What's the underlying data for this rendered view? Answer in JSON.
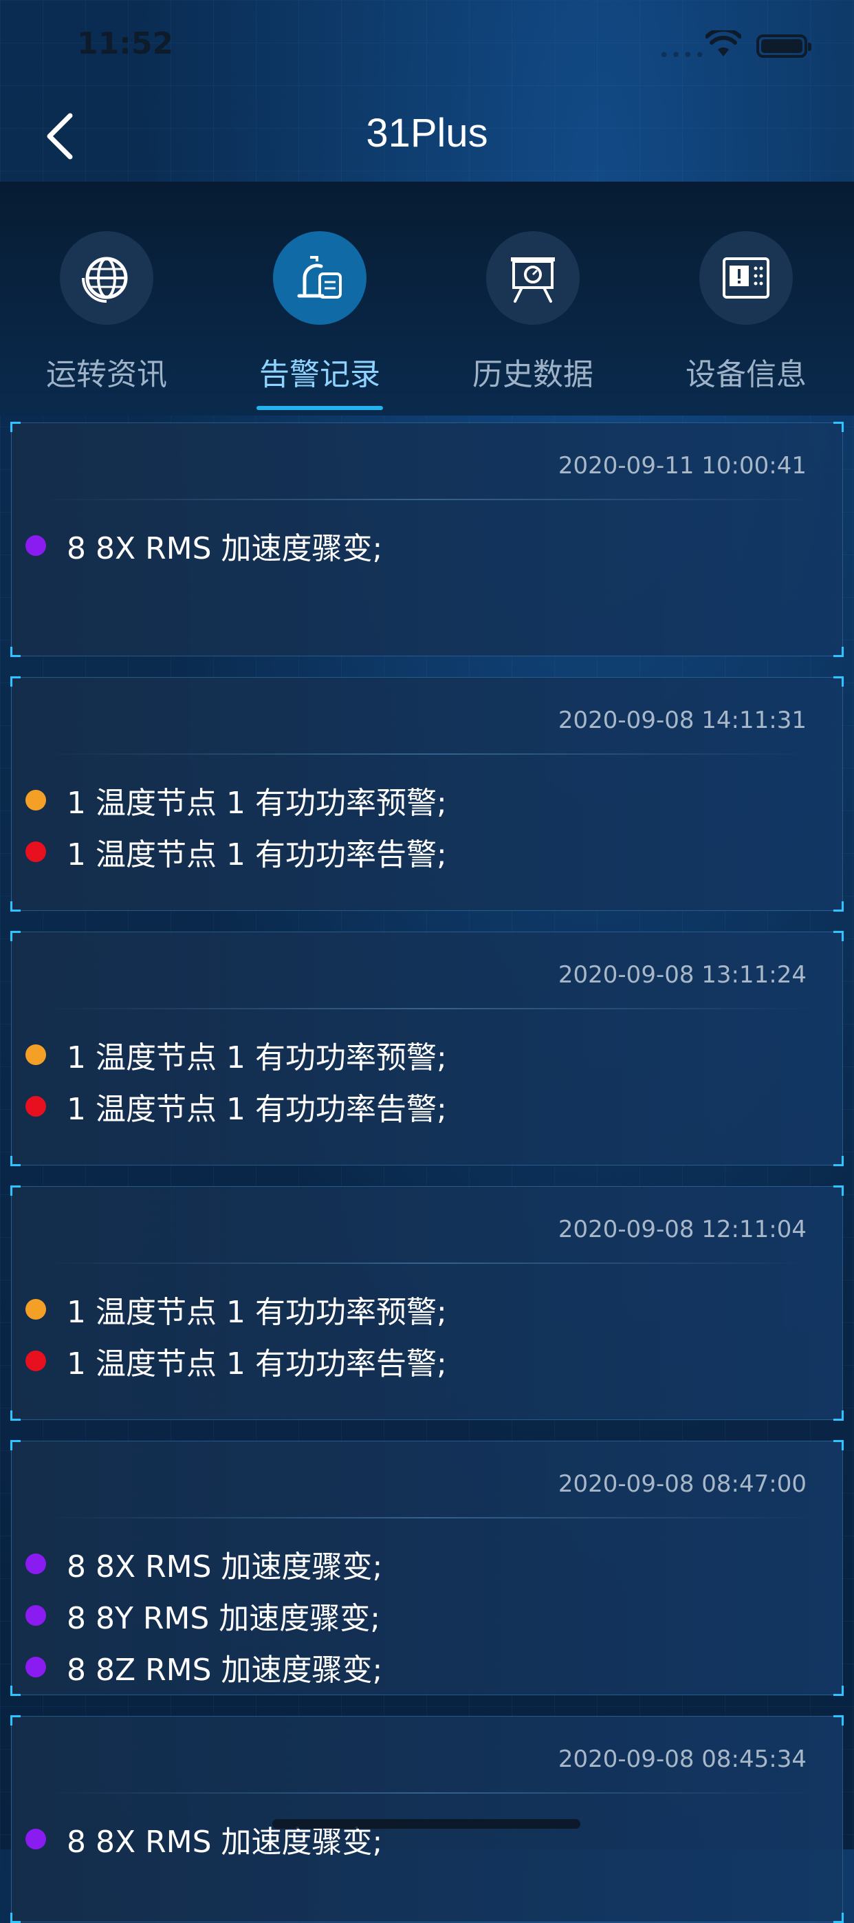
{
  "status": {
    "time": "11:52",
    "signal": "••••"
  },
  "nav": {
    "title": "31Plus"
  },
  "tabs": [
    {
      "label": "运转资讯",
      "icon": "globe-icon",
      "active": false
    },
    {
      "label": "告警记录",
      "icon": "alarm-bell-icon",
      "active": true
    },
    {
      "label": "历史数据",
      "icon": "presentation-gauge-icon",
      "active": false
    },
    {
      "label": "设备信息",
      "icon": "device-info-icon",
      "active": false
    }
  ],
  "colors": {
    "purple": "#8a1cf2",
    "orange": "#f4a026",
    "red": "#e8101e",
    "accent": "#25b3f0"
  },
  "records": [
    {
      "time": "2020-09-11 10:00:41",
      "alarms": [
        {
          "level": "purple",
          "text": "8 8X RMS 加速度骤变;"
        }
      ]
    },
    {
      "time": "2020-09-08 14:11:31",
      "alarms": [
        {
          "level": "orange",
          "text": "1 温度节点 1 有功功率预警;"
        },
        {
          "level": "red",
          "text": "1 温度节点 1 有功功率告警;"
        }
      ]
    },
    {
      "time": "2020-09-08 13:11:24",
      "alarms": [
        {
          "level": "orange",
          "text": "1 温度节点 1 有功功率预警;"
        },
        {
          "level": "red",
          "text": "1 温度节点 1 有功功率告警;"
        }
      ]
    },
    {
      "time": "2020-09-08 12:11:04",
      "alarms": [
        {
          "level": "orange",
          "text": "1 温度节点 1 有功功率预警;"
        },
        {
          "level": "red",
          "text": "1 温度节点 1 有功功率告警;"
        }
      ]
    },
    {
      "time": "2020-09-08 08:47:00",
      "alarms": [
        {
          "level": "purple",
          "text": "8 8X RMS 加速度骤变;"
        },
        {
          "level": "purple",
          "text": "8 8Y RMS 加速度骤变;"
        },
        {
          "level": "purple",
          "text": "8 8Z RMS 加速度骤变;"
        }
      ]
    },
    {
      "time": "2020-09-08 08:45:34",
      "alarms": [
        {
          "level": "purple",
          "text": "8 8X RMS 加速度骤变;"
        }
      ]
    }
  ]
}
